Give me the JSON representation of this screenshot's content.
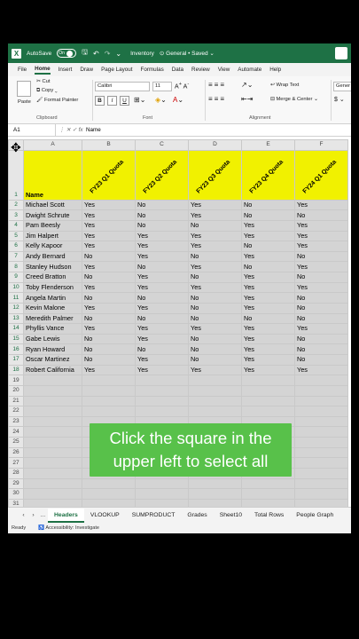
{
  "titlebar": {
    "autosave_label": "AutoSave",
    "autosave_state": "On",
    "doc_name": "Inventory",
    "sensitivity": "General",
    "saved_status": "Saved"
  },
  "menu": [
    "File",
    "Home",
    "Insert",
    "Draw",
    "Page Layout",
    "Formulas",
    "Data",
    "Review",
    "View",
    "Automate",
    "Help"
  ],
  "ribbon": {
    "paste": "Paste",
    "cut": "Cut",
    "copy": "Copy",
    "format_painter": "Format Painter",
    "clipboard_label": "Clipboard",
    "font_name": "Calibri",
    "font_size": "11",
    "font_label": "Font",
    "bold": "B",
    "italic": "I",
    "underline": "U",
    "wrap_text": "Wrap Text",
    "merge_center": "Merge & Center",
    "alignment_label": "Alignment",
    "number_format": "Gener",
    "currency": "$"
  },
  "formula_bar": {
    "name_box": "A1",
    "fx": "fx",
    "value": "Name"
  },
  "grid": {
    "col_letters": [
      "A",
      "B",
      "C",
      "D",
      "E",
      "F"
    ],
    "header_name": "Name",
    "quota_headers": [
      "FY23 Q1 Quota",
      "FY23 Q2 Quota",
      "FY23 Q3 Quota",
      "FY23 Q4 Quota",
      "FY24 Q1 Quota"
    ],
    "rows": [
      [
        "Michael Scott",
        "Yes",
        "No",
        "Yes",
        "No",
        "Yes"
      ],
      [
        "Dwight Schrute",
        "Yes",
        "No",
        "Yes",
        "No",
        "No"
      ],
      [
        "Pam Beesly",
        "Yes",
        "No",
        "No",
        "Yes",
        "Yes"
      ],
      [
        "Jim Halpert",
        "Yes",
        "Yes",
        "Yes",
        "Yes",
        "Yes"
      ],
      [
        "Kelly Kapoor",
        "Yes",
        "Yes",
        "Yes",
        "No",
        "Yes"
      ],
      [
        "Andy Bernard",
        "No",
        "Yes",
        "No",
        "Yes",
        "No"
      ],
      [
        "Stanley Hudson",
        "Yes",
        "No",
        "Yes",
        "No",
        "Yes"
      ],
      [
        "Creed Bratton",
        "No",
        "Yes",
        "No",
        "Yes",
        "No"
      ],
      [
        "Toby Flenderson",
        "Yes",
        "Yes",
        "Yes",
        "Yes",
        "Yes"
      ],
      [
        "Angela Martin",
        "No",
        "No",
        "No",
        "Yes",
        "No"
      ],
      [
        "Kevin Malone",
        "Yes",
        "Yes",
        "No",
        "Yes",
        "No"
      ],
      [
        "Meredith Palmer",
        "No",
        "No",
        "No",
        "No",
        "No"
      ],
      [
        "Phyllis Vance",
        "Yes",
        "Yes",
        "Yes",
        "Yes",
        "Yes"
      ],
      [
        "Gabe Lewis",
        "No",
        "Yes",
        "No",
        "Yes",
        "No"
      ],
      [
        "Ryan Howard",
        "No",
        "No",
        "No",
        "Yes",
        "No"
      ],
      [
        "Oscar Martinez",
        "No",
        "Yes",
        "No",
        "Yes",
        "No"
      ],
      [
        "Robert California",
        "Yes",
        "Yes",
        "Yes",
        "Yes",
        "Yes"
      ]
    ],
    "empty_rows_from": 19,
    "empty_rows_to": 32
  },
  "caption": "Click the square in the upper left to select all",
  "sheet_tabs": {
    "tabs": [
      "Headers",
      "VLOOKUP",
      "SUMPRODUCT",
      "Grades",
      "Sheet10",
      "Total Rows",
      "People Graph"
    ],
    "active": "Headers",
    "more": "..."
  },
  "status": {
    "ready": "Ready",
    "accessibility": "Accessibility: Investigate"
  }
}
